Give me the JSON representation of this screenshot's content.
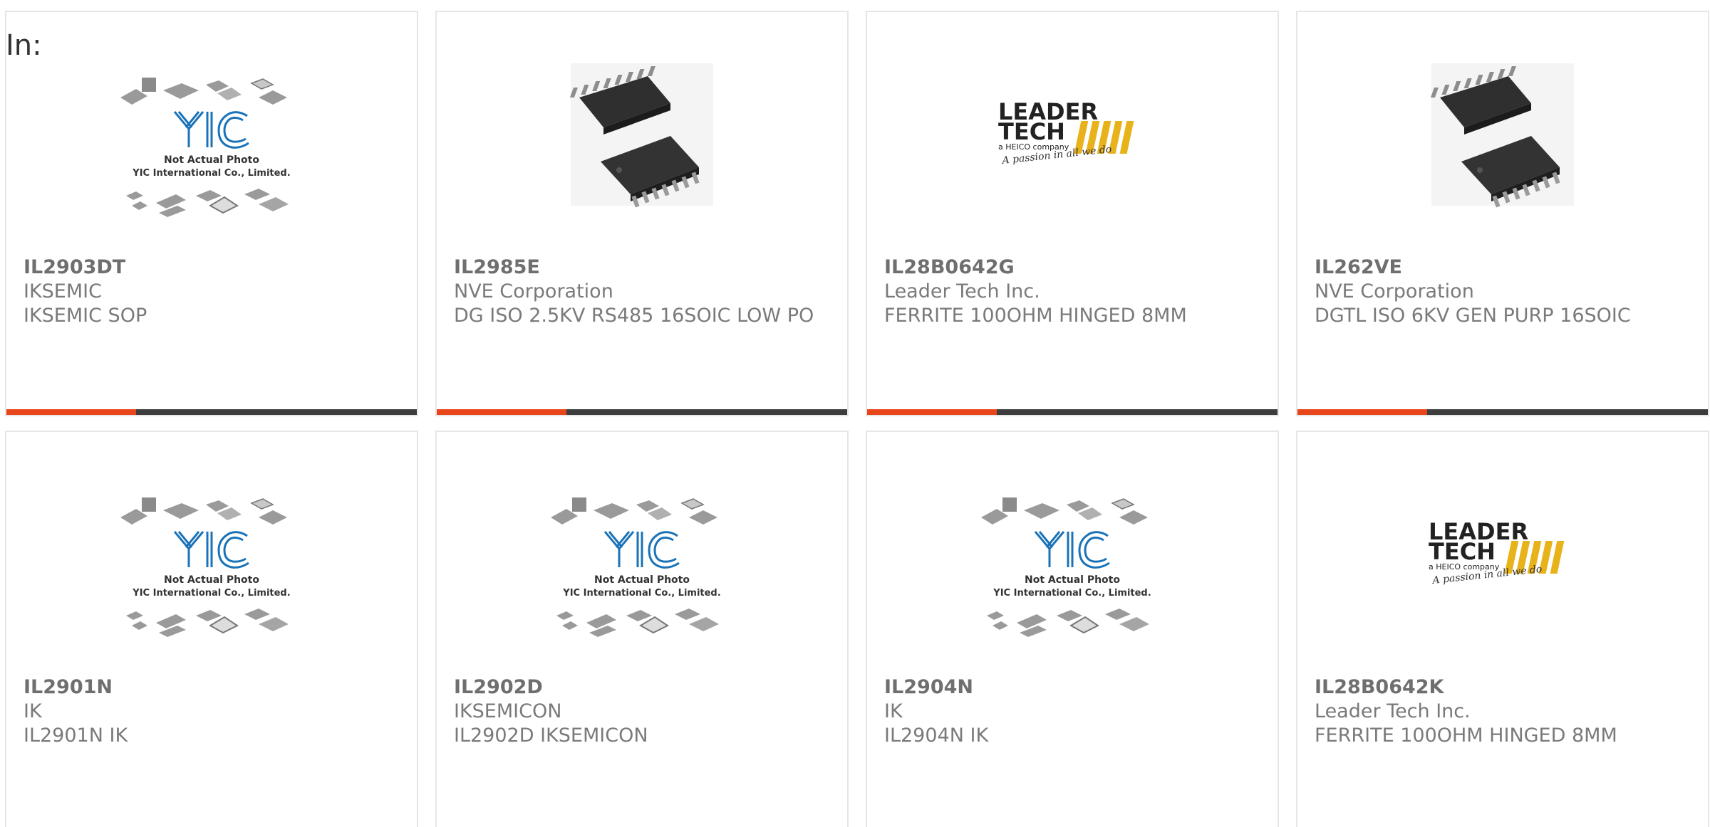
{
  "filter_label": "In:",
  "products": [
    {
      "part_number": "IL2903DT",
      "manufacturer": "IKSEMIC",
      "description": "IKSEMIC SOP",
      "image": "yic-placeholder",
      "image_caption_line1": "Not Actual Photo",
      "image_caption_line2": "YIC International Co., Limited."
    },
    {
      "part_number": "IL2985E",
      "manufacturer": "NVE Corporation",
      "description": "DG ISO 2.5KV RS485 16SOIC LOW PO",
      "image": "soic-chip-photo"
    },
    {
      "part_number": "IL28B0642G",
      "manufacturer": "Leader Tech Inc.",
      "description": "FERRITE 100OHM HINGED 8MM",
      "image": "leader-tech-logo",
      "logo_line1": "LEADER",
      "logo_line2": "TECH",
      "logo_sub": "a HEICO company",
      "logo_tagline": "A passion in all we do"
    },
    {
      "part_number": "IL262VE",
      "manufacturer": "NVE Corporation",
      "description": "DGTL ISO 6KV GEN PURP 16SOIC",
      "image": "soic-chip-photo"
    },
    {
      "part_number": "IL2901N",
      "manufacturer": "IK",
      "description": "IL2901N IK",
      "image": "yic-placeholder",
      "image_caption_line1": "Not Actual Photo",
      "image_caption_line2": "YIC International Co., Limited."
    },
    {
      "part_number": "IL2902D",
      "manufacturer": "IKSEMICON",
      "description": "IL2902D IKSEMICON",
      "image": "yic-placeholder",
      "image_caption_line1": "Not Actual Photo",
      "image_caption_line2": "YIC International Co., Limited."
    },
    {
      "part_number": "IL2904N",
      "manufacturer": "IK",
      "description": "IL2904N IK",
      "image": "yic-placeholder",
      "image_caption_line1": "Not Actual Photo",
      "image_caption_line2": "YIC International Co., Limited."
    },
    {
      "part_number": "IL28B0642K",
      "manufacturer": "Leader Tech Inc.",
      "description": "FERRITE 100OHM HINGED 8MM",
      "image": "leader-tech-logo",
      "logo_line1": "LEADER",
      "logo_line2": "TECH",
      "logo_sub": "a HEICO company",
      "logo_tagline": "A passion in all we do"
    }
  ],
  "colors": {
    "accent": "#e8461a",
    "bar": "#3d3d3d",
    "border": "#e6e6e6",
    "text": "#7a7a7a",
    "yic_blue": "#1a73b8",
    "leader_gold": "#e8b21a"
  }
}
